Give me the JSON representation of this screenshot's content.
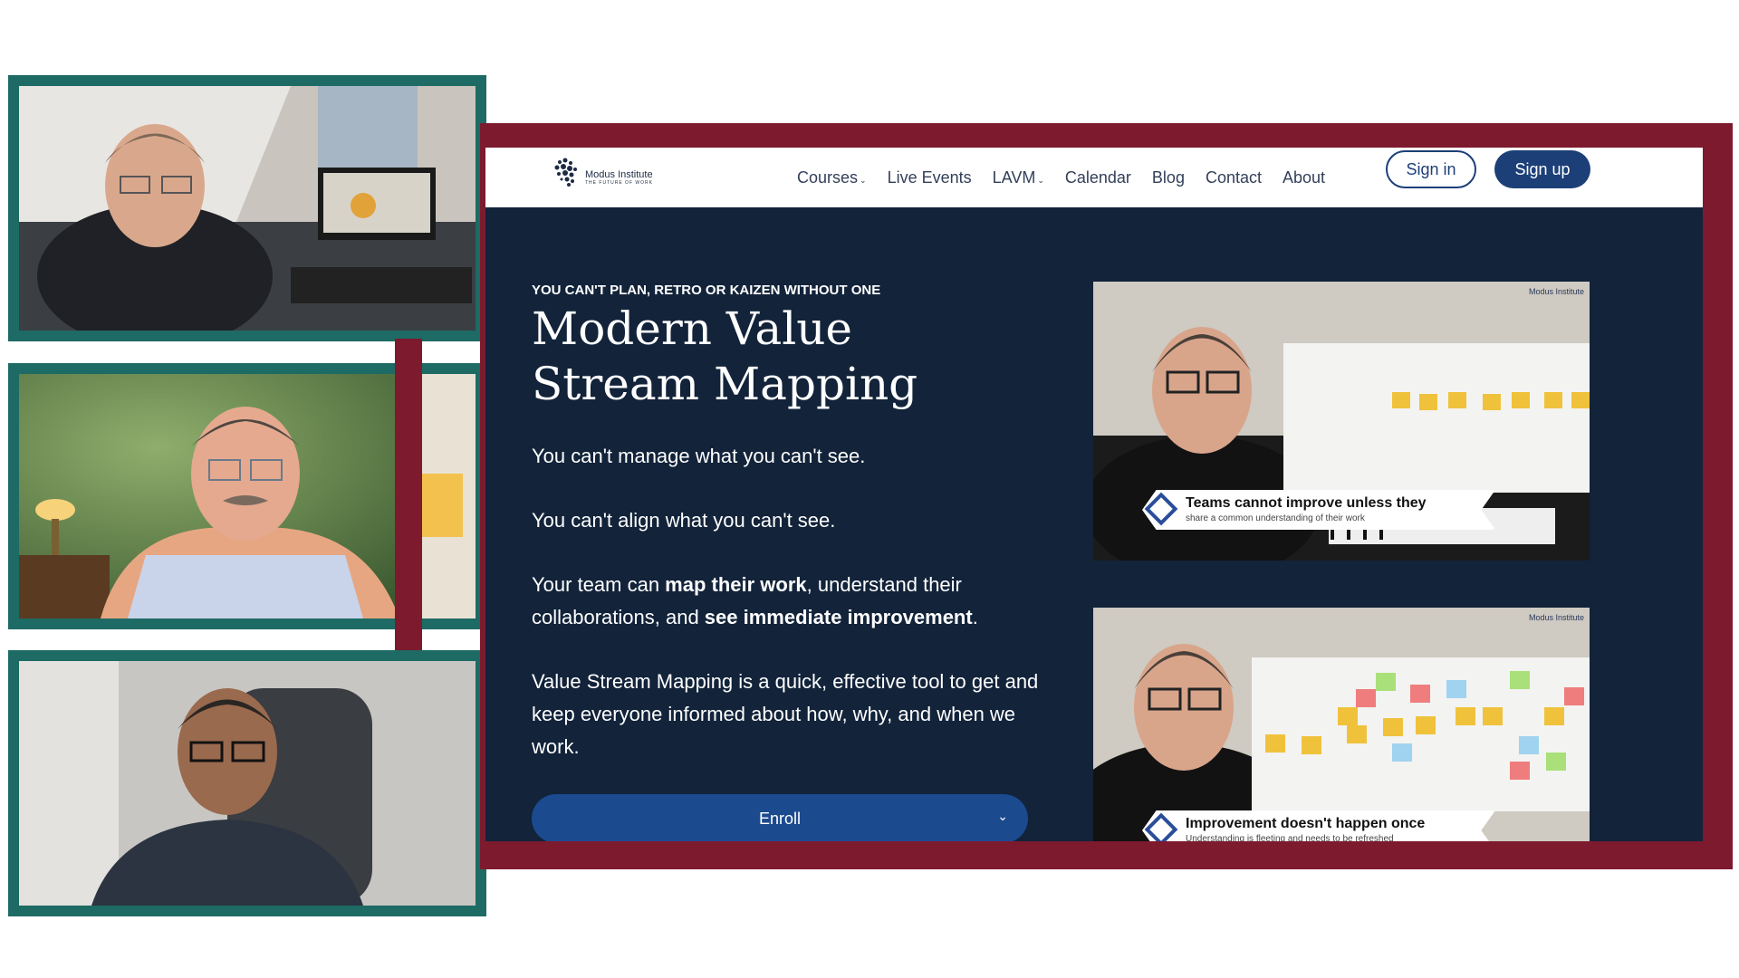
{
  "site": {
    "logo": {
      "name": "Modus Institute",
      "tagline": "THE FUTURE OF WORK"
    },
    "nav": [
      {
        "label": "Courses",
        "has_dropdown": true
      },
      {
        "label": "Live Events",
        "has_dropdown": false
      },
      {
        "label": "LAVM",
        "has_dropdown": true
      },
      {
        "label": "Calendar",
        "has_dropdown": false
      },
      {
        "label": "Blog",
        "has_dropdown": false
      },
      {
        "label": "Contact",
        "has_dropdown": false
      },
      {
        "label": "About",
        "has_dropdown": false
      }
    ],
    "signin_label": "Sign in",
    "signup_label": "Sign up",
    "eyebrow": "YOU CAN'T PLAN, RETRO OR KAIZEN WITHOUT ONE",
    "title": "Modern Value Stream Mapping",
    "para1": "You can't manage what you can't see.",
    "para2": "You can't align what you can't see.",
    "para3": {
      "a": "Your team can ",
      "b": "map their work",
      "c": ", understand their collaborations, and ",
      "d": "see immediate improvement",
      "e": "."
    },
    "para4": "Value Stream Mapping is a quick, effective tool to get and keep everyone informed about how, why, and when we work.",
    "enroll_label": "Enroll",
    "videos": [
      {
        "caption_title": "Teams cannot improve unless they",
        "caption_sub": "share a common understanding of their work",
        "logo": "Modus Institute"
      },
      {
        "caption_title": "Improvement doesn't happen once",
        "caption_sub": "Understanding is fleeting and needs to be refreshed",
        "logo": "Modus Institute"
      }
    ]
  },
  "icons": {
    "nav_caret": "chevron-down-icon",
    "enroll_chevron": "chevron-down-icon",
    "logo": "modus-logo-icon"
  },
  "colors": {
    "tile_border": "#1e6a64",
    "frame": "#7d1a2e",
    "site_bg": "#12233a",
    "primary": "#1c3f78",
    "enroll": "#1c4a8f"
  }
}
